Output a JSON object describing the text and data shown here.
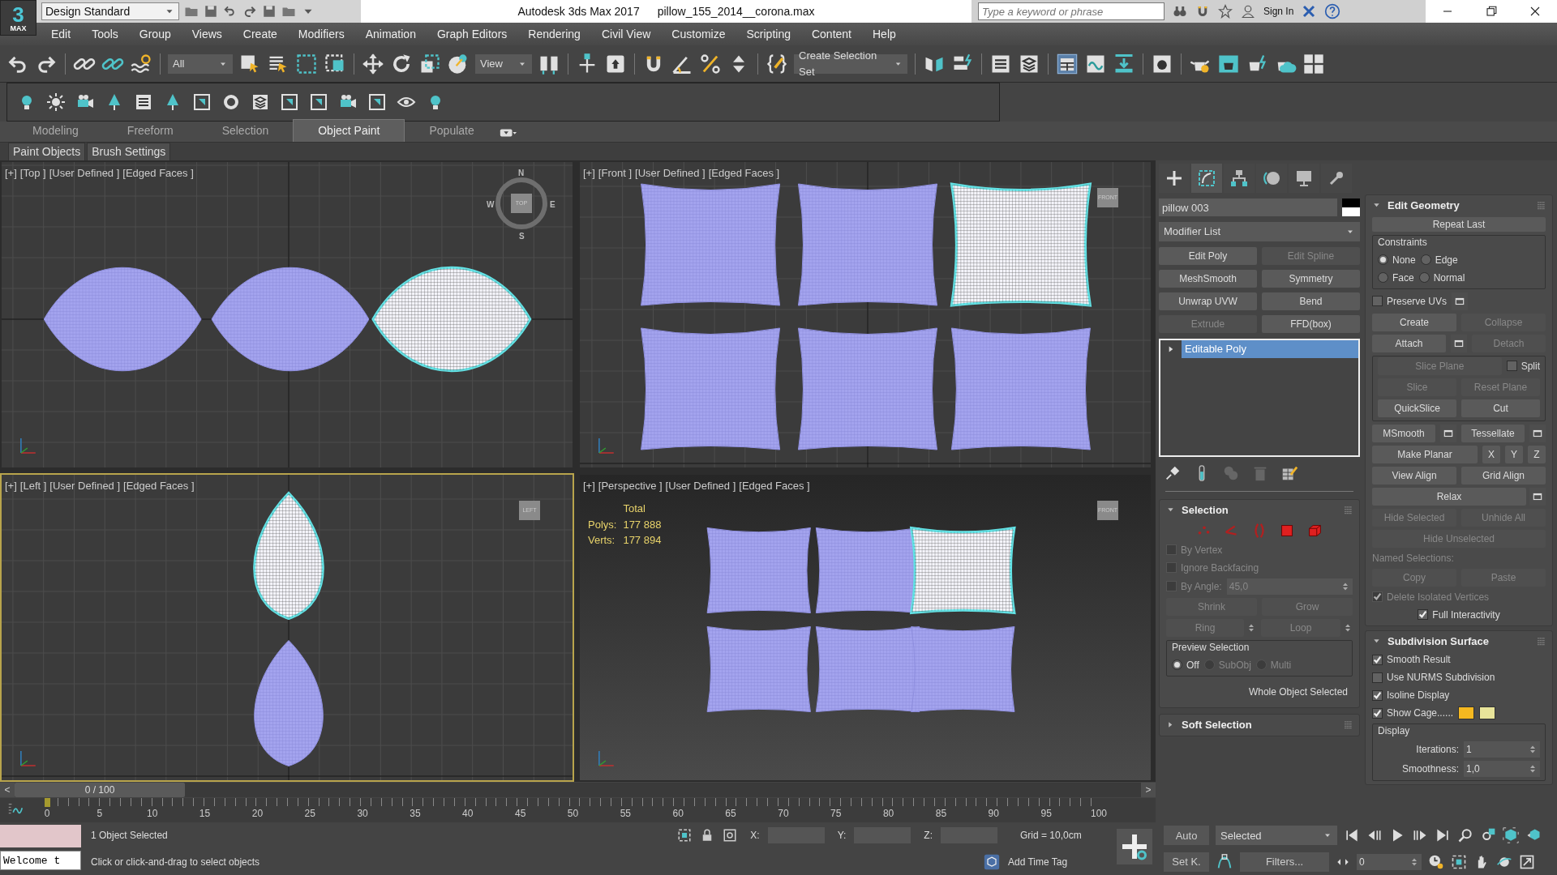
{
  "window": {
    "logo": {
      "digit": "3",
      "word": "MAX"
    },
    "workspace": "Design Standard",
    "app": "Autodesk 3ds Max 2017",
    "file": "pillow_155_2014__corona.max",
    "search_placeholder": "Type a keyword or phrase",
    "sign_in": "Sign In"
  },
  "menu": [
    "Edit",
    "Tools",
    "Group",
    "Views",
    "Create",
    "Modifiers",
    "Animation",
    "Graph Editors",
    "Rendering",
    "Civil View",
    "Customize",
    "Scripting",
    "Content",
    "Help"
  ],
  "main_toolbar": {
    "selection_filter": "All",
    "reference_coordinate": "View",
    "named_selection": "Create Selection Set"
  },
  "ribbon": {
    "tabs": [
      {
        "label": "Modeling",
        "selected": false
      },
      {
        "label": "Freeform",
        "selected": false
      },
      {
        "label": "Selection",
        "selected": false
      },
      {
        "label": "Object Paint",
        "selected": true
      },
      {
        "label": "Populate",
        "selected": false
      }
    ],
    "panels": [
      "Paint Objects",
      "Brush Settings"
    ]
  },
  "viewports": [
    {
      "kind": "top",
      "active": false,
      "labels": [
        "[+]",
        "[Top ]",
        "[User Defined ]",
        "[Edged Faces ]"
      ],
      "compass": [
        "N",
        "W",
        "E",
        "S"
      ],
      "cube_label": "TOP",
      "objects": [
        {
          "selected": false
        },
        {
          "selected": false
        },
        {
          "selected": true
        }
      ]
    },
    {
      "kind": "front",
      "active": false,
      "labels": [
        "[+]",
        "[Front ]",
        "[User Defined ]",
        "[Edged Faces ]"
      ],
      "cube_label": "FRONT",
      "objects": [
        {
          "selected": false
        },
        {
          "selected": false
        },
        {
          "selected": true
        },
        {
          "selected": false
        },
        {
          "selected": false
        },
        {
          "selected": false
        }
      ]
    },
    {
      "kind": "left",
      "active": true,
      "labels": [
        "[+]",
        "[Left ]",
        "[User Defined ]",
        "[Edged Faces ]"
      ],
      "cube_label": "LEFT",
      "objects": [
        {
          "selected": true
        },
        {
          "selected": false
        }
      ]
    },
    {
      "kind": "perspective",
      "active": false,
      "labels": [
        "[+]",
        "[Perspective ]",
        "[User Defined ]",
        "[Edged Faces ]"
      ],
      "cube_label": "FRONT",
      "stats": {
        "title": "Total",
        "rows": [
          {
            "label": "Polys:",
            "value": "177 888"
          },
          {
            "label": "Verts:",
            "value": "177 894"
          }
        ]
      },
      "objects": [
        {
          "selected": false
        },
        {
          "selected": false
        },
        {
          "selected": true
        },
        {
          "selected": false
        },
        {
          "selected": false
        },
        {
          "selected": false
        }
      ]
    }
  ],
  "command_panel": {
    "tabs": [
      {
        "kind": "create",
        "selected": false
      },
      {
        "kind": "modify",
        "selected": true
      },
      {
        "kind": "hierarchy",
        "selected": false
      },
      {
        "kind": "motion",
        "selected": false
      },
      {
        "kind": "display",
        "selected": false
      },
      {
        "kind": "utilities",
        "selected": false
      }
    ],
    "object_name": "pillow 003",
    "modifier_list": "Modifier List",
    "modifier_buttons": [
      {
        "label": "Edit Poly",
        "disabled": false
      },
      {
        "label": "Edit Spline",
        "disabled": true
      },
      {
        "label": "MeshSmooth",
        "disabled": false
      },
      {
        "label": "Symmetry",
        "disabled": false
      },
      {
        "label": "Unwrap UVW",
        "disabled": false
      },
      {
        "label": "Bend",
        "disabled": false
      },
      {
        "label": "Extrude",
        "disabled": true
      },
      {
        "label": "FFD(box)",
        "disabled": false
      }
    ],
    "stack": [
      {
        "label": "Editable Poly",
        "selected": true,
        "expanded": false
      }
    ],
    "left_rollouts": [
      {
        "title": "Selection",
        "expanded": true,
        "rows": [
          {
            "kind": "row",
            "items": [
              {
                "kind": "vertex"
              },
              {
                "kind": "edge"
              },
              {
                "kind": "border"
              },
              {
                "kind": "polygon"
              },
              {
                "kind": "element"
              }
            ]
          },
          {
            "kind": "checkbox",
            "label": "By Vertex",
            "checked": false,
            "disabled": true
          },
          {
            "kind": "checkbox",
            "label": "Ignore Backfacing",
            "checked": false,
            "disabled": true
          },
          {
            "kind": "row",
            "items": [
              {
                "kind": "checkbox",
                "label": "By Angle:",
                "checked": false,
                "disabled": true
              },
              {
                "kind": "spinner",
                "value": "45,0",
                "disabled": true
              }
            ]
          },
          {
            "kind": "row",
            "items": [
              {
                "kind": "button",
                "label": "Shrink",
                "disabled": true
              },
              {
                "kind": "button",
                "label": "Grow",
                "disabled": true
              }
            ]
          },
          {
            "kind": "row",
            "items": [
              {
                "kind": "button",
                "label": "Ring",
                "disabled": true,
                "arrows": true
              },
              {
                "kind": "button",
                "label": "Loop",
                "disabled": true,
                "arrows": true
              }
            ]
          },
          {
            "kind": "group",
            "title": "Preview Selection",
            "rows": [
              {
                "kind": "row",
                "items": [
                  {
                    "kind": "radio",
                    "label": "Off",
                    "selected": true,
                    "disabled": false
                  },
                  {
                    "kind": "radio",
                    "label": "SubObj",
                    "selected": false,
                    "disabled": true
                  },
                  {
                    "kind": "radio",
                    "label": "Multi",
                    "selected": false,
                    "disabled": true
                  }
                ]
              }
            ]
          },
          {
            "kind": "note",
            "label": "Whole Object Selected",
            "disabled": false
          }
        ]
      },
      {
        "title": "Soft Selection",
        "expanded": false
      }
    ],
    "right_rollouts": [
      {
        "title": "Edit Geometry",
        "expanded": true,
        "rows": [
          {
            "kind": "button",
            "label": "Repeat Last",
            "disabled": false
          },
          {
            "kind": "group",
            "title": "Constraints",
            "rows": [
              {
                "kind": "row",
                "items": [
                  {
                    "kind": "radio",
                    "label": "None",
                    "selected": true,
                    "disabled": false
                  },
                  {
                    "kind": "radio",
                    "label": "Edge",
                    "selected": false,
                    "disabled": false
                  }
                ]
              },
              {
                "kind": "row",
                "items": [
                  {
                    "kind": "radio",
                    "label": "Face",
                    "selected": false,
                    "disabled": false
                  },
                  {
                    "kind": "radio",
                    "label": "Normal",
                    "selected": false,
                    "disabled": false
                  }
                ]
              }
            ]
          },
          {
            "kind": "row",
            "items": [
              {
                "kind": "checkbox",
                "label": "Preserve UVs",
                "checked": false,
                "disabled": false
              },
              {
                "kind": "settings"
              }
            ]
          },
          {
            "kind": "row",
            "items": [
              {
                "kind": "button",
                "label": "Create",
                "disabled": false
              },
              {
                "kind": "button",
                "label": "Collapse",
                "disabled": true
              }
            ]
          },
          {
            "kind": "row",
            "items": [
              {
                "kind": "button",
                "label": "Attach",
                "disabled": false
              },
              {
                "kind": "settings"
              },
              {
                "kind": "button",
                "label": "Detach",
                "disabled": true
              }
            ]
          },
          {
            "kind": "group",
            "rows": [
              {
                "kind": "row",
                "items": [
                  {
                    "kind": "button",
                    "label": "Slice Plane",
                    "disabled": true
                  },
                  {
                    "kind": "checkbox",
                    "label": "Split",
                    "checked": false,
                    "disabled": false
                  }
                ]
              },
              {
                "kind": "row",
                "items": [
                  {
                    "kind": "button",
                    "label": "Slice",
                    "disabled": true
                  },
                  {
                    "kind": "button",
                    "label": "Reset Plane",
                    "disabled": true
                  }
                ]
              },
              {
                "kind": "row",
                "items": [
                  {
                    "kind": "button",
                    "label": "QuickSlice",
                    "disabled": false
                  },
                  {
                    "kind": "button",
                    "label": "Cut",
                    "disabled": false
                  }
                ]
              }
            ]
          },
          {
            "kind": "row",
            "items": [
              {
                "kind": "button",
                "label": "MSmooth",
                "disabled": false
              },
              {
                "kind": "settings"
              },
              {
                "kind": "button",
                "label": "Tessellate",
                "disabled": false
              },
              {
                "kind": "settings"
              }
            ]
          },
          {
            "kind": "row",
            "items": [
              {
                "kind": "button",
                "label": "Make Planar",
                "disabled": false
              },
              {
                "kind": "axis",
                "label": "X",
                "disabled": false
              },
              {
                "kind": "axis",
                "label": "Y",
                "disabled": false
              },
              {
                "kind": "axis",
                "label": "Z",
                "disabled": false
              }
            ]
          },
          {
            "kind": "row",
            "items": [
              {
                "kind": "button",
                "label": "View Align",
                "disabled": false
              },
              {
                "kind": "button",
                "label": "Grid Align",
                "disabled": false
              }
            ]
          },
          {
            "kind": "center_row",
            "items": [
              {
                "kind": "button",
                "label": "Relax",
                "disabled": false
              },
              {
                "kind": "settings"
              }
            ]
          },
          {
            "kind": "row",
            "items": [
              {
                "kind": "button",
                "label": "Hide Selected",
                "disabled": true
              },
              {
                "kind": "button",
                "label": "Unhide All",
                "disabled": true
              }
            ]
          },
          {
            "kind": "center_row",
            "items": [
              {
                "kind": "button",
                "label": "Hide Unselected",
                "disabled": true
              }
            ]
          },
          {
            "kind": "text",
            "label": "Named Selections:",
            "disabled": true
          },
          {
            "kind": "row",
            "items": [
              {
                "kind": "button",
                "label": "Copy",
                "disabled": true
              },
              {
                "kind": "button",
                "label": "Paste",
                "disabled": true
              }
            ]
          },
          {
            "kind": "checkbox",
            "label": "Delete Isolated Vertices",
            "checked": true,
            "disabled": true
          },
          {
            "kind": "center_row",
            "items": [
              {
                "kind": "checkbox",
                "label": "Full Interactivity",
                "checked": true,
                "disabled": false
              }
            ]
          }
        ]
      },
      {
        "title": "Subdivision Surface",
        "expanded": true,
        "rows": [
          {
            "kind": "checkbox",
            "label": "Smooth Result",
            "checked": true,
            "disabled": false
          },
          {
            "kind": "checkbox",
            "label": "Use NURMS Subdivision",
            "checked": false,
            "disabled": false
          },
          {
            "kind": "checkbox",
            "label": "Isoline Display",
            "checked": true,
            "disabled": false
          },
          {
            "kind": "row",
            "items": [
              {
                "kind": "checkbox",
                "label": "Show Cage......",
                "checked": true,
                "disabled": false
              },
              {
                "kind": "swatch",
                "color": "#f5b820"
              },
              {
                "kind": "swatch",
                "color": "#e8e49a"
              }
            ]
          },
          {
            "kind": "group",
            "title": "Display",
            "rows": [
              {
                "kind": "spinner",
                "label": "Iterations:",
                "value": "1",
                "disabled": false
              },
              {
                "kind": "spinner",
                "label": "Smoothness:",
                "value": "1,0",
                "disabled": false
              }
            ]
          }
        ]
      }
    ]
  },
  "timeline": {
    "position": "0 / 100",
    "prev": "<",
    "next": ">",
    "ticks": [
      "0",
      "5",
      "10",
      "15",
      "20",
      "25",
      "30",
      "35",
      "40",
      "45",
      "50",
      "55",
      "60",
      "65",
      "70",
      "75",
      "80",
      "85",
      "90",
      "95",
      "100"
    ]
  },
  "status": {
    "listener": "Welcome t",
    "selection": "1 Object Selected",
    "prompt": "Click or click-and-drag to select objects",
    "coords": [
      "X:",
      "Y:",
      "Z:"
    ],
    "grid": "Grid = 10,0cm",
    "time_tag": "Add Time Tag"
  },
  "animation": {
    "auto": "Auto",
    "set_key": "Set K.",
    "key_set": "Selected",
    "filters": "Filters...",
    "frame": "0"
  }
}
